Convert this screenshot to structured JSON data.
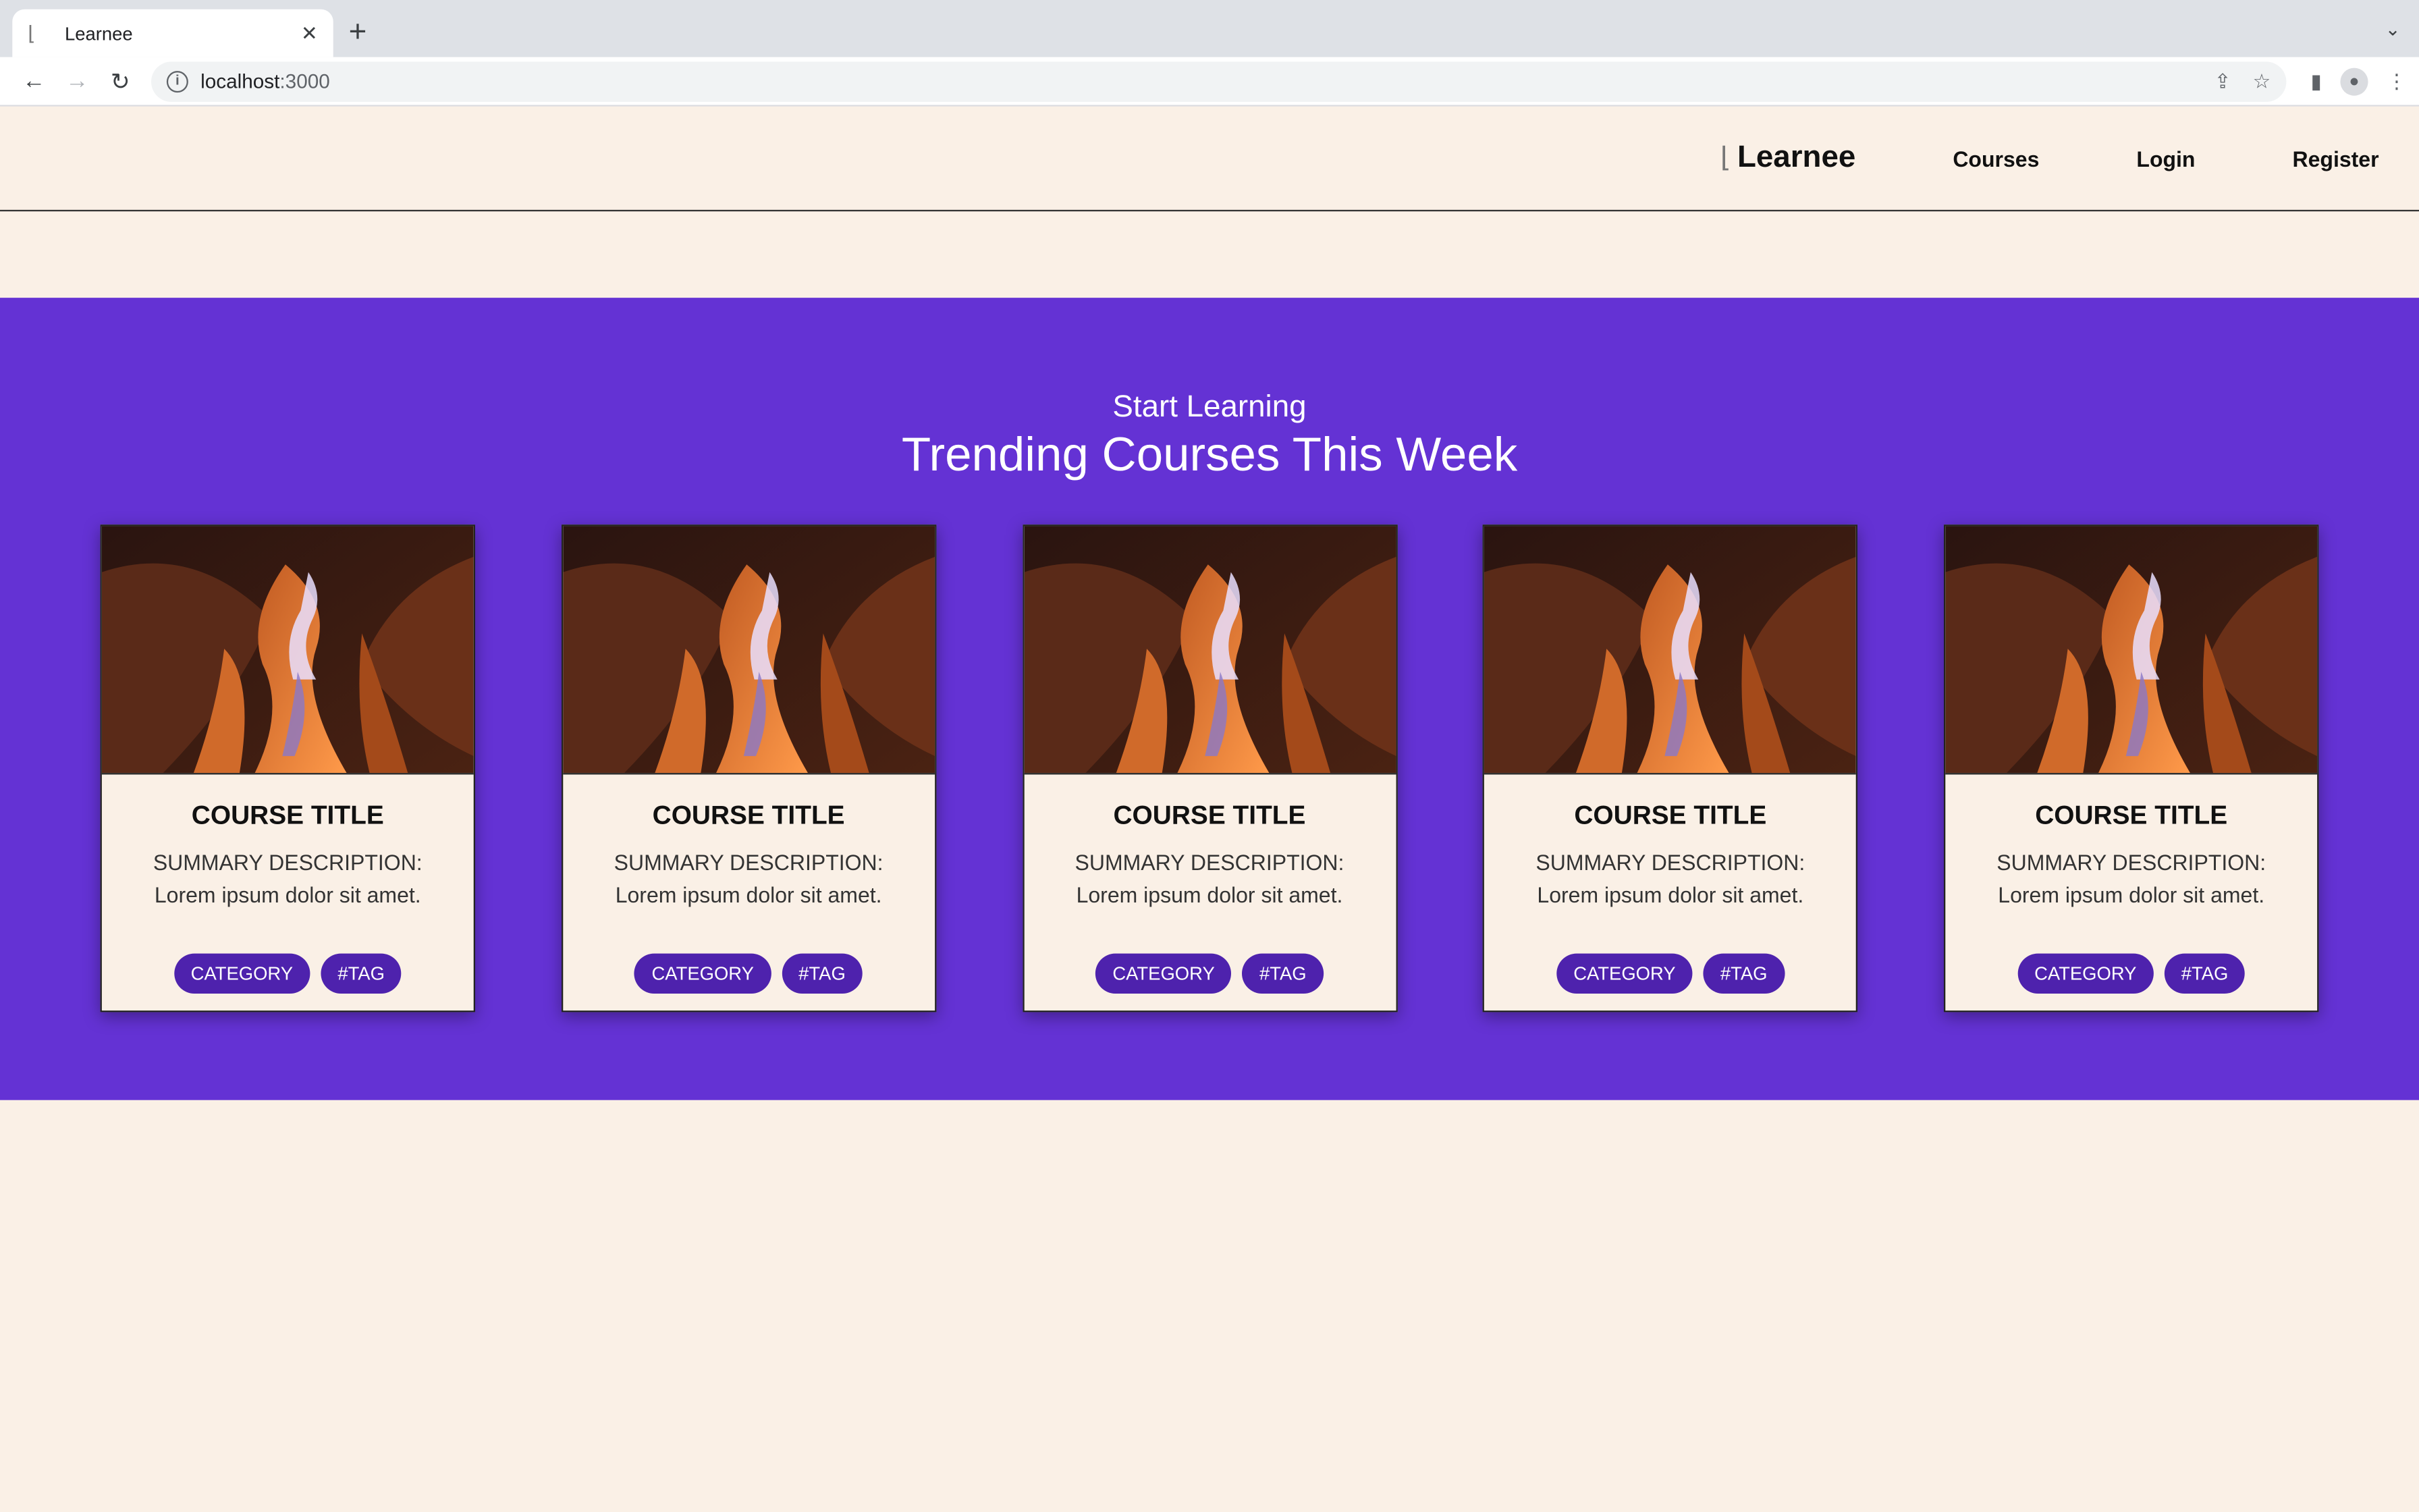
{
  "browser": {
    "tab_title": "Learnee",
    "url_host": "localhost",
    "url_port": ":3000"
  },
  "nav": {
    "brand": "Learnee",
    "links": [
      "Courses",
      "Login",
      "Register"
    ]
  },
  "hero": {
    "kicker": "Start Learning",
    "headline": "Trending Courses This Week"
  },
  "cards": [
    {
      "title": "COURSE TITLE",
      "desc_line1": "SUMMARY DESCRIPTION:",
      "desc_line2": "Lorem ipsum dolor sit amet.",
      "category": "CATEGORY",
      "tag": "#TAG"
    },
    {
      "title": "COURSE TITLE",
      "desc_line1": "SUMMARY DESCRIPTION:",
      "desc_line2": "Lorem ipsum dolor sit amet.",
      "category": "CATEGORY",
      "tag": "#TAG"
    },
    {
      "title": "COURSE TITLE",
      "desc_line1": "SUMMARY DESCRIPTION:",
      "desc_line2": "Lorem ipsum dolor sit amet.",
      "category": "CATEGORY",
      "tag": "#TAG"
    },
    {
      "title": "COURSE TITLE",
      "desc_line1": "SUMMARY DESCRIPTION:",
      "desc_line2": "Lorem ipsum dolor sit amet.",
      "category": "CATEGORY",
      "tag": "#TAG"
    },
    {
      "title": "COURSE TITLE",
      "desc_line1": "SUMMARY DESCRIPTION:",
      "desc_line2": "Lorem ipsum dolor sit amet.",
      "category": "CATEGORY",
      "tag": "#TAG"
    }
  ],
  "colors": {
    "page_bg": "#faf0e6",
    "hero_bg": "#6432d4",
    "chip_bg": "#4e22ad"
  },
  "icons": [
    "back-icon",
    "forward-icon",
    "reload-icon",
    "info-icon",
    "share-icon",
    "star-icon",
    "sidepanel-icon",
    "profile-icon",
    "menu-icon",
    "logo-icon"
  ]
}
